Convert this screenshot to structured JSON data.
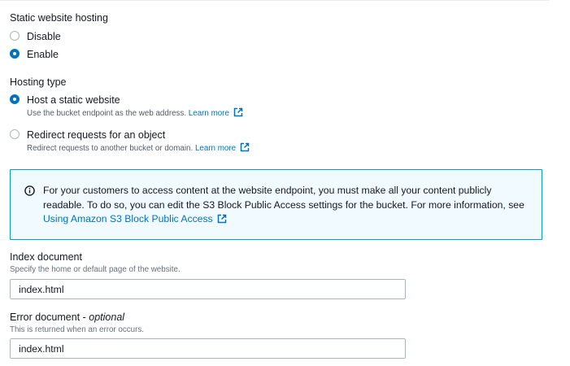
{
  "static_hosting": {
    "label": "Static website hosting",
    "options": [
      {
        "label": "Disable",
        "checked": false
      },
      {
        "label": "Enable",
        "checked": true
      }
    ]
  },
  "hosting_type": {
    "label": "Hosting type",
    "options": [
      {
        "label": "Host a static website",
        "description": "Use the bucket endpoint as the web address.",
        "link": "Learn more",
        "checked": true
      },
      {
        "label": "Redirect requests for an object",
        "description": "Redirect requests to another bucket or domain.",
        "link": "Learn more",
        "checked": false
      }
    ]
  },
  "info_alert": {
    "text": "For your customers to access content at the website endpoint, you must make all your content publicly readable. To do so, you can edit the S3 Block Public Access settings for the bucket. For more information, see",
    "link": "Using Amazon S3 Block Public Access"
  },
  "index_document": {
    "label": "Index document",
    "description": "Specify the home or default page of the website.",
    "value": "index.html"
  },
  "error_document": {
    "label": "Error document - ",
    "optional": "optional",
    "description": "This is returned when an error occurs.",
    "value": "index.html"
  },
  "colors": {
    "accent": "#0073bb",
    "info_border": "#00a1c9",
    "info_background": "#f1faff"
  }
}
